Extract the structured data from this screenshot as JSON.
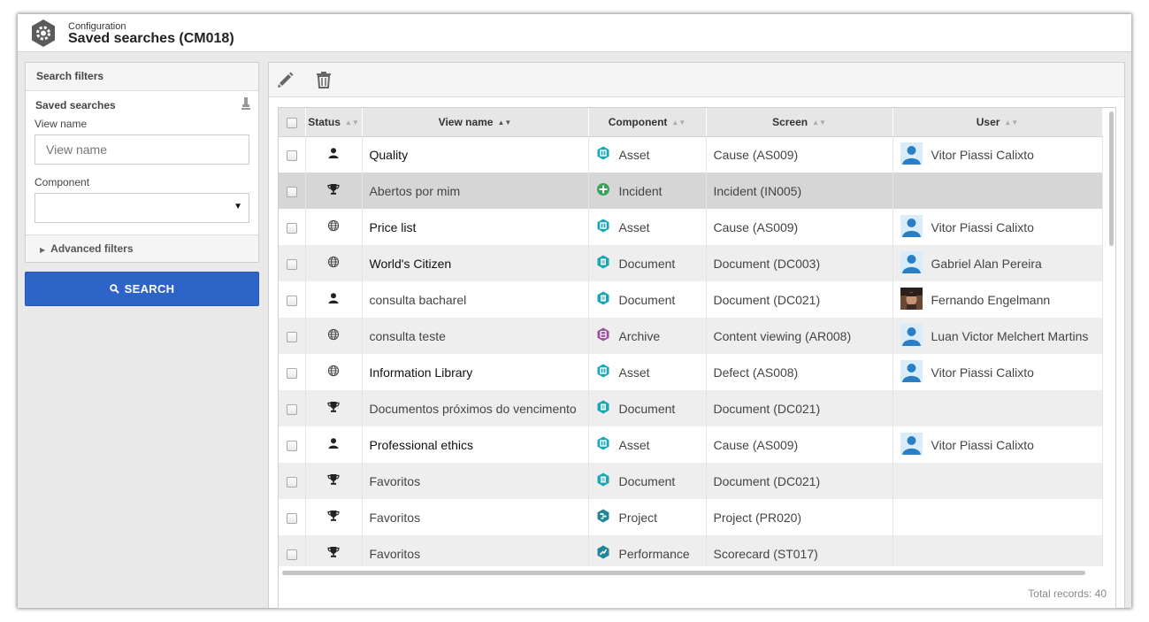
{
  "header": {
    "subtitle": "Configuration",
    "title": "Saved searches (CM018)"
  },
  "filters": {
    "title": "Search filters",
    "saved_searches_label": "Saved searches",
    "view_name_label": "View name",
    "view_name_placeholder": "View name",
    "component_label": "Component",
    "component_value": "",
    "advanced_label": "Advanced filters",
    "search_button": "SEARCH"
  },
  "colors": {
    "accent": "#2e63c8",
    "teal": "#19a6b5",
    "green": "#3aa45a",
    "purple": "#9b4e9e",
    "selected_row": "#d6d6d6",
    "alt_row": "#eeeeee"
  },
  "toolbar": {
    "edit_icon": "pencil-icon",
    "delete_icon": "trash-icon"
  },
  "grid": {
    "columns": {
      "status": "Status",
      "view_name": "View name",
      "component": "Component",
      "screen": "Screen",
      "user": "User"
    },
    "rows": [
      {
        "status": "user-icon",
        "name": "Quality",
        "component": "Asset",
        "screen": "Cause (AS009)",
        "user": "Vitor Piassi Calixto"
      },
      {
        "status": "trophy-icon",
        "name": "Abertos por mim",
        "component": "Incident",
        "screen": "Incident (IN005)",
        "user": ""
      },
      {
        "status": "globe-icon",
        "name": "Price list",
        "component": "Asset",
        "screen": "Cause (AS009)",
        "user": "Vitor Piassi Calixto"
      },
      {
        "status": "globe-icon",
        "name": "World's Citizen",
        "component": "Document",
        "screen": "Document (DC003)",
        "user": "Gabriel Alan Pereira"
      },
      {
        "status": "user-icon",
        "name": "consulta bacharel",
        "component": "Document",
        "screen": "Document (DC021)",
        "user": "Fernando Engelmann"
      },
      {
        "status": "globe-icon",
        "name": "consulta teste",
        "component": "Archive",
        "screen": "Content viewing (AR008)",
        "user": "Luan Victor Melchert Martins"
      },
      {
        "status": "globe-icon",
        "name": "Information Library",
        "component": "Asset",
        "screen": "Defect (AS008)",
        "user": "Vitor Piassi Calixto"
      },
      {
        "status": "trophy-icon",
        "name": "Documentos próximos do vencimento",
        "component": "Document",
        "screen": "Document (DC021)",
        "user": ""
      },
      {
        "status": "user-icon",
        "name": "Professional ethics",
        "component": "Asset",
        "screen": "Cause (AS009)",
        "user": "Vitor Piassi Calixto"
      },
      {
        "status": "trophy-icon",
        "name": "Favoritos",
        "component": "Document",
        "screen": "Document (DC021)",
        "user": ""
      },
      {
        "status": "trophy-icon",
        "name": "Favoritos",
        "component": "Project",
        "screen": "Project (PR020)",
        "user": ""
      },
      {
        "status": "trophy-icon",
        "name": "Favoritos",
        "component": "Performance",
        "screen": "Scorecard (ST017)",
        "user": ""
      }
    ],
    "total_records": "Total records: 40"
  }
}
